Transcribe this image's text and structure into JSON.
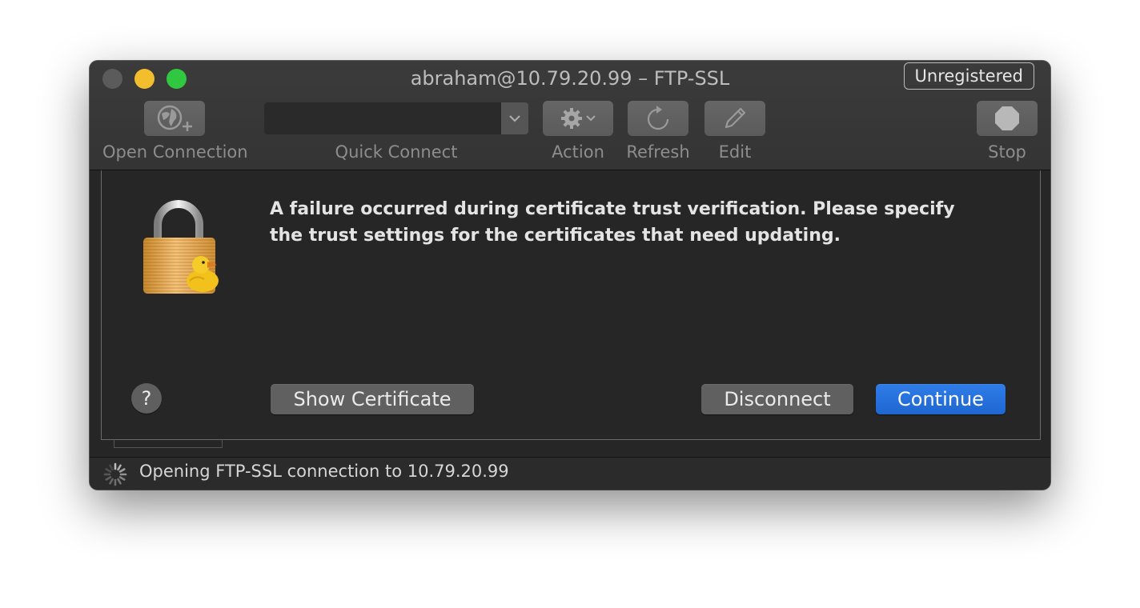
{
  "window": {
    "title": "abraham@10.79.20.99 – FTP-SSL",
    "badge": "Unregistered"
  },
  "toolbar": {
    "open_connection": "Open Connection",
    "quick_connect": "Quick Connect",
    "action": "Action",
    "refresh": "Refresh",
    "edit": "Edit",
    "stop": "Stop"
  },
  "dialog": {
    "message": "A failure occurred during certificate trust verification. Please specify the trust settings for the certificates that need updating.",
    "help_label": "?",
    "show_certificate_label": "Show Certificate",
    "disconnect_label": "Disconnect",
    "continue_label": "Continue"
  },
  "status": {
    "text": "Opening FTP-SSL connection to 10.79.20.99"
  },
  "colors": {
    "accent": "#1f66d0",
    "close": "#5b5b5b",
    "minimize": "#f3be2e",
    "maximize": "#2fc840"
  }
}
